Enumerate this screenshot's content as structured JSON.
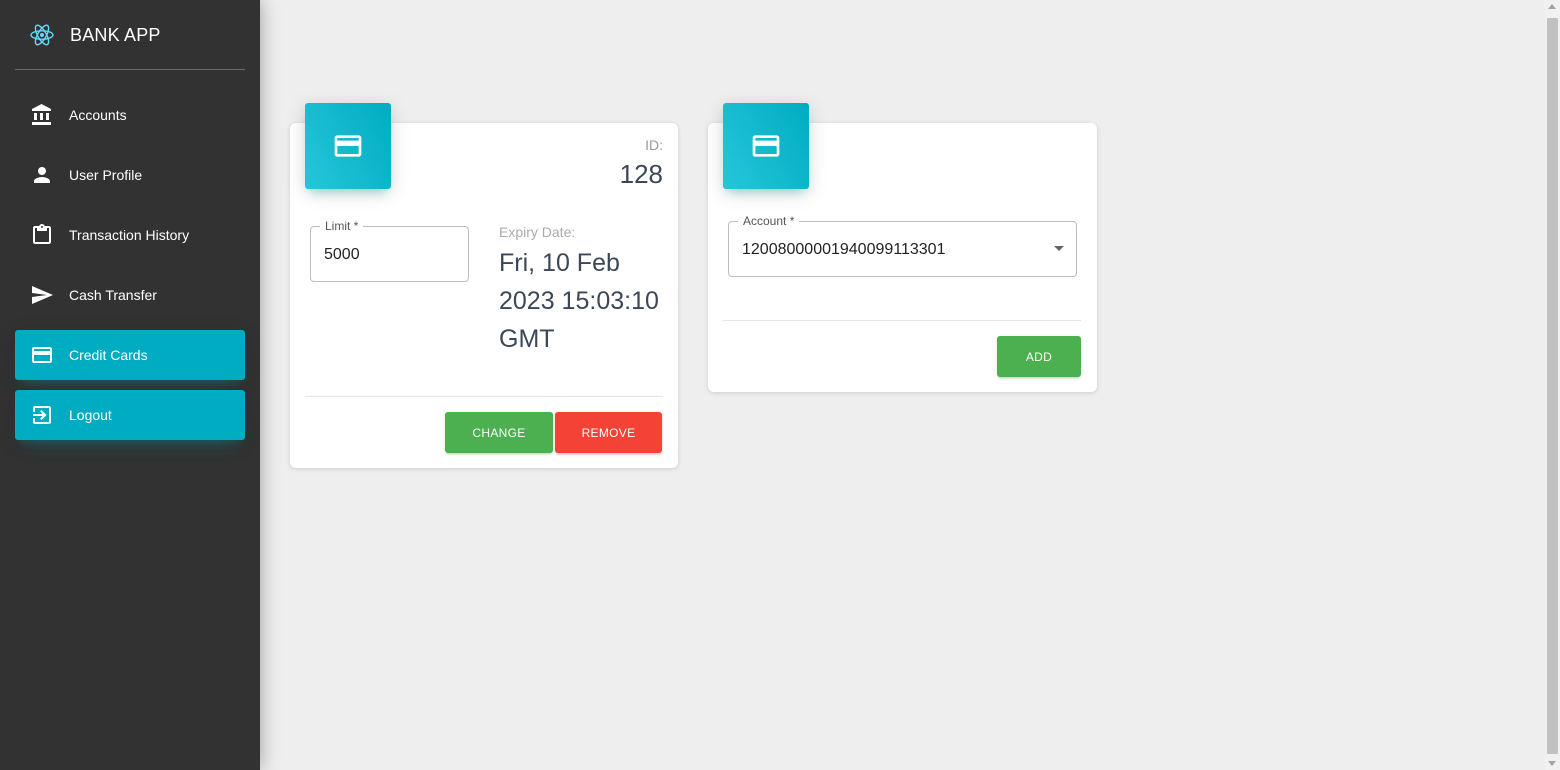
{
  "brand": {
    "name": "BANK APP",
    "logo_icon": "react-atom-icon"
  },
  "sidebar": {
    "items": [
      {
        "label": "Accounts",
        "icon": "bank-icon",
        "active": false
      },
      {
        "label": "User Profile",
        "icon": "person-icon",
        "active": false
      },
      {
        "label": "Transaction History",
        "icon": "clipboard-icon",
        "active": false
      },
      {
        "label": "Cash Transfer",
        "icon": "send-icon",
        "active": false
      },
      {
        "label": "Credit Cards",
        "icon": "credit-card-icon",
        "active": true
      },
      {
        "label": "Logout",
        "icon": "logout-icon",
        "active": true
      }
    ]
  },
  "card_existing": {
    "icon": "credit-card-icon",
    "id_label": "ID:",
    "id_value": "128",
    "limit_label": "Limit *",
    "limit_value": "5000",
    "expiry_label": "Expiry Date:",
    "expiry_lines": [
      "Fri, 10 Feb",
      "2023 15:03:10",
      "GMT"
    ],
    "change_button": "CHANGE",
    "remove_button": "REMOVE"
  },
  "card_new": {
    "icon": "credit-card-icon",
    "account_label": "Account *",
    "account_value": "12008000001940099113301",
    "add_button": "ADD"
  },
  "colors": {
    "sidebar_bg": "#323232",
    "active_nav": "#00acc1",
    "page_bg": "#eeeeee",
    "primary_green": "#4caf50",
    "danger_red": "#f44336"
  }
}
